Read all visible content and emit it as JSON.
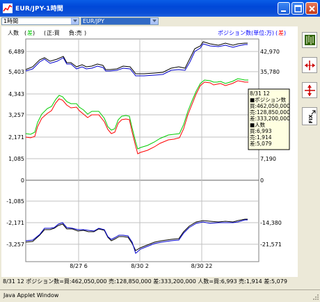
{
  "window": {
    "title": "EUR/JPY-1時間"
  },
  "toolbar": {
    "timeframe": "1時間",
    "symbol": "EUR/JPY"
  },
  "header": {
    "left_label_prefix": "人数",
    "left_label_mode": "差",
    "legend_buy": "正:買",
    "legend_sell": "負:売",
    "right_label_prefix": "ポジション数(単位:万)",
    "right_label_mode": "差"
  },
  "axes": {
    "left_ticks": [
      "6,489",
      "5,403",
      "4,343",
      "3,257",
      "2,171",
      "1,085",
      "0",
      "-1,085",
      "-2,171",
      "-3,257"
    ],
    "right_ticks": [
      "42,970",
      "35,780",
      "7,190",
      "0",
      "-14,380",
      "-21,571"
    ],
    "x_ticks": [
      "8/27 6",
      "8/30 2",
      "8/30 22"
    ]
  },
  "tooltip": {
    "lines": [
      "8/31 12",
      "■ポジション数",
      "買:462,050,000",
      "売:128,850,000",
      "差:333,200,000",
      "■人数",
      "買:6,993",
      "売:1,914",
      "差:5,079"
    ]
  },
  "status": {
    "text": "8/31 12  ポジション数=買:462,050,000 売:128,850,000 差:333,200,000 人数=買:6,993 売:1,914 差:5,079"
  },
  "applet": {
    "label": "Java Applet Window"
  },
  "colors": {
    "black_line": "#000000",
    "blue_line": "#0000cc",
    "red_line": "#ff0000",
    "green_line": "#00cc00",
    "mode_label": "#00cc00",
    "right_label": "#0000ff",
    "right_mode": "#ff0000"
  },
  "sidebar": {
    "buttons": [
      "chart-type-icon",
      "crosshair-horizontal-icon",
      "crosshair-vertical-icon",
      "fix-icon"
    ]
  }
}
